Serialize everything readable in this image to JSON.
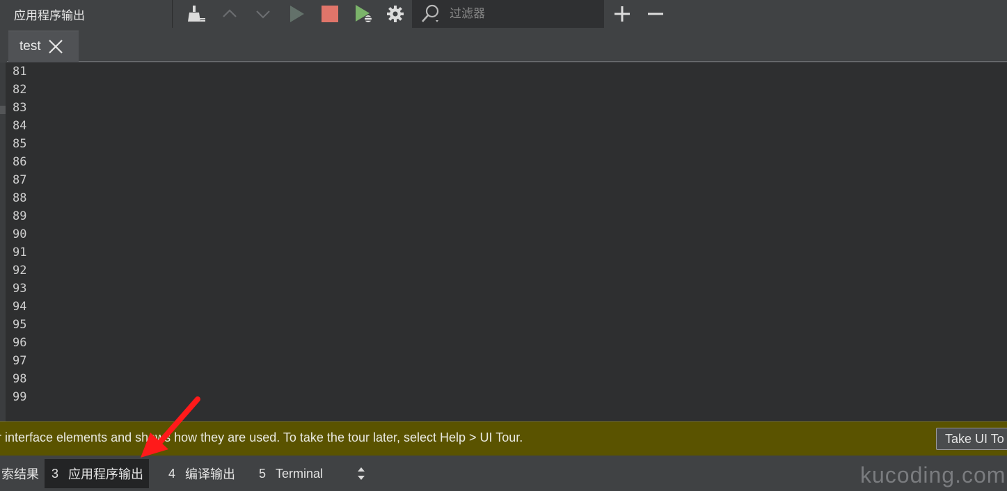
{
  "toolbar": {
    "pane_title": "应用程序输出",
    "filter_placeholder": "过滤器",
    "buttons": [
      "clear-output-icon",
      "previous-icon",
      "next-icon",
      "run-icon",
      "stop-icon",
      "debug-run-icon",
      "settings-icon"
    ],
    "stop_color": "#e0756a",
    "run_color": "#63716a",
    "debug_color": "#7bb36a"
  },
  "tab": {
    "label": "test"
  },
  "output_lines": [
    "81",
    "82",
    "83",
    "84",
    "85",
    "86",
    "87",
    "88",
    "89",
    "90",
    "91",
    "92",
    "93",
    "94",
    "95",
    "96",
    "97",
    "98",
    "99"
  ],
  "infobar": {
    "text": "r interface elements and shows how they are used. To take the tour later, select Help > UI Tour.",
    "button_label": "Take UI To",
    "background": "#5a5300"
  },
  "bottom_tabs": [
    {
      "num": "",
      "label": "索结果",
      "active": false
    },
    {
      "num": "3",
      "label": "应用程序输出",
      "active": true
    },
    {
      "num": "4",
      "label": "编译输出",
      "active": false
    },
    {
      "num": "5",
      "label": "Terminal",
      "active": false
    }
  ],
  "watermark": "kucoding.com",
  "annotation_color": "#ff1a1a"
}
